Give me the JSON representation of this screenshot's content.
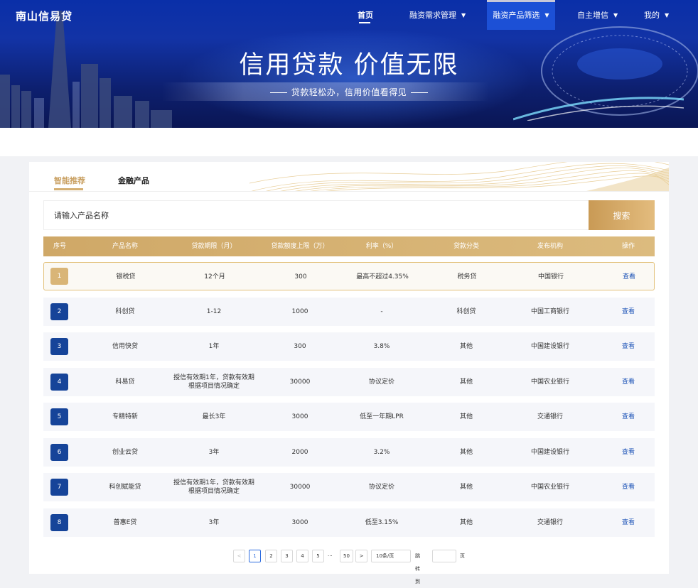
{
  "brand": "南山信易贷",
  "nav": {
    "home": "首页",
    "demand": "融资需求管理",
    "product_filter": "融资产品筛选",
    "credit": "自主增信",
    "mine": "我的",
    "caret": "▼"
  },
  "hero": {
    "title": "信用贷款 价值无限",
    "subtitle": "贷款轻松办，信用价值看得见"
  },
  "tabs": [
    "智能推荐",
    "金融产品"
  ],
  "search": {
    "placeholder": "请输入产品名称",
    "button": "搜索"
  },
  "table": {
    "headers": [
      "序号",
      "产品名称",
      "贷款期限（月）",
      "贷款额度上限（万）",
      "利率（%）",
      "贷款分类",
      "发布机构",
      "操作"
    ],
    "rows": [
      {
        "no": "1",
        "name": "银税贷",
        "term": "12个月",
        "limit": "300",
        "rate": "最高不超过4.35%",
        "category": "税务贷",
        "org": "中国银行",
        "action": "查看"
      },
      {
        "no": "2",
        "name": "科创贷",
        "term": "1-12",
        "limit": "1000",
        "rate": "-",
        "category": "科创贷",
        "org": "中国工商银行",
        "action": "查看"
      },
      {
        "no": "3",
        "name": "信用快贷",
        "term": "1年",
        "limit": "300",
        "rate": "3.8%",
        "category": "其他",
        "org": "中国建设银行",
        "action": "查看"
      },
      {
        "no": "4",
        "name": "科易贷",
        "term": "授信有效期1年，贷款有效期根据项目情况确定",
        "limit": "30000",
        "rate": "协议定价",
        "category": "其他",
        "org": "中国农业银行",
        "action": "查看"
      },
      {
        "no": "5",
        "name": "专精特新",
        "term": "最长3年",
        "limit": "3000",
        "rate": "低至一年期LPR",
        "category": "其他",
        "org": "交通银行",
        "action": "查看"
      },
      {
        "no": "6",
        "name": "创业云贷",
        "term": "3年",
        "limit": "2000",
        "rate": "3.2%",
        "category": "其他",
        "org": "中国建设银行",
        "action": "查看"
      },
      {
        "no": "7",
        "name": "科创赋能贷",
        "term": "授信有效期1年，贷款有效期根据项目情况确定",
        "limit": "30000",
        "rate": "协议定价",
        "category": "其他",
        "org": "中国农业银行",
        "action": "查看"
      },
      {
        "no": "8",
        "name": "普惠E贷",
        "term": "3年",
        "limit": "3000",
        "rate": "低至3.15%",
        "category": "其他",
        "org": "交通银行",
        "action": "查看"
      }
    ]
  },
  "pagination": {
    "prev": "<",
    "pages": [
      "1",
      "2",
      "3",
      "4",
      "5"
    ],
    "ellipsis": "···",
    "last": "50",
    "next": ">",
    "page_size": "10条/页",
    "goto_label": "跳转到",
    "goto_value": "",
    "page_unit": "页",
    "current": "1"
  },
  "colors": {
    "gold": "#d4af72",
    "navy": "#164499",
    "link": "#1f55b8",
    "banner": "#0a2fa8"
  }
}
